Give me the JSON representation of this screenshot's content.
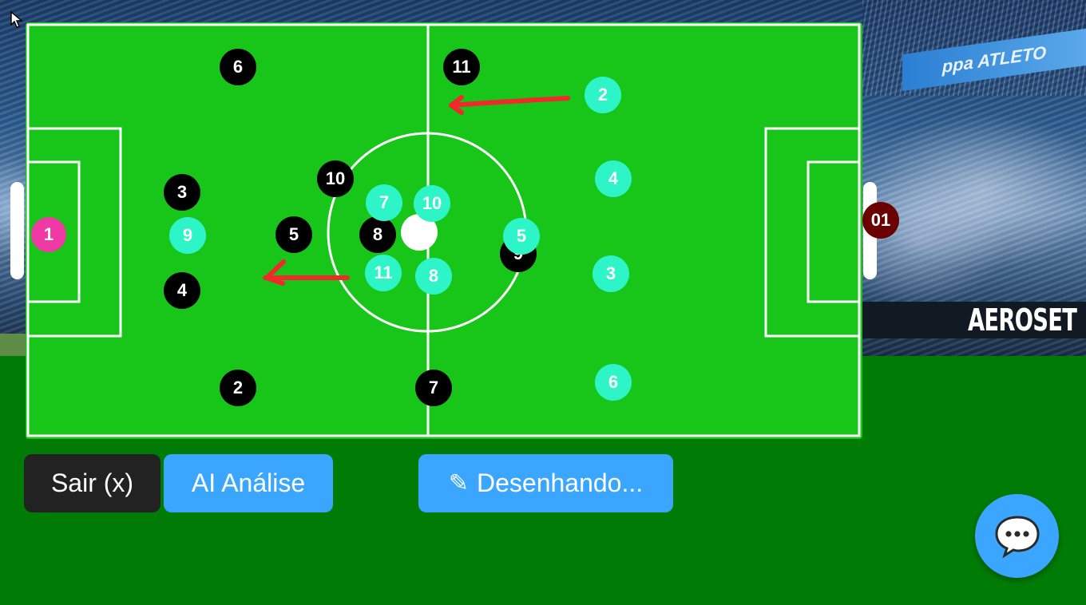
{
  "stadium": {
    "ad_text": "AEROSET",
    "banner_text": "ppa  ATLETO"
  },
  "pitch": {
    "goalkeeper_home": "1",
    "goalkeeper_away": "01",
    "black_players": [
      "6",
      "11",
      "3",
      "10",
      "5",
      "8",
      "9",
      "4",
      "2",
      "7"
    ],
    "cyan_players": [
      "2",
      "4",
      "7",
      "10",
      "9",
      "5",
      "3",
      "11",
      "8",
      "6"
    ]
  },
  "toolbar": {
    "exit_label": "Sair (x)",
    "ai_label": "AI Análise",
    "draw_icon": "pencil-icon",
    "draw_label": "Desenhando..."
  },
  "chat": {
    "icon": "speech-bubble-icon"
  },
  "colors": {
    "pitch": "#18c519",
    "background": "#007c06",
    "team_black": "#000000",
    "team_cyan": "#2ef5c7",
    "goalkeeper_home": "#ef3aa5",
    "goalkeeper_away": "#6b0000",
    "arrow": "#f02a2a",
    "button_blue": "#3aa6ff",
    "button_dark": "#222222"
  }
}
